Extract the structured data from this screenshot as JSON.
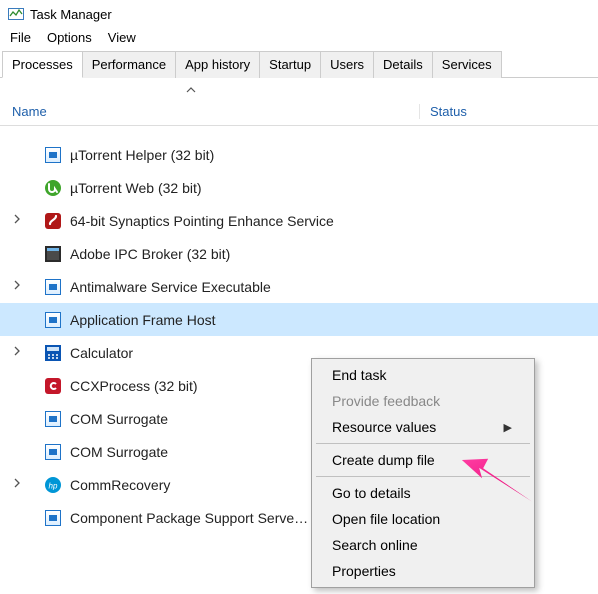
{
  "window": {
    "title": "Task Manager"
  },
  "menubar": {
    "file": "File",
    "options": "Options",
    "view": "View"
  },
  "tabs": {
    "processes": "Processes",
    "performance": "Performance",
    "app_history": "App history",
    "startup": "Startup",
    "users": "Users",
    "details": "Details",
    "services": "Services"
  },
  "columns": {
    "name": "Name",
    "status": "Status"
  },
  "processes": [
    {
      "name": "µTorrent Helper (32 bit)",
      "expandable": false,
      "icon": "app-generic"
    },
    {
      "name": "µTorrent Web (32 bit)",
      "expandable": false,
      "icon": "utorrent"
    },
    {
      "name": "64-bit Synaptics Pointing Enhance Service",
      "expandable": true,
      "icon": "synaptics"
    },
    {
      "name": "Adobe IPC Broker (32 bit)",
      "expandable": false,
      "icon": "adobe-ipc"
    },
    {
      "name": "Antimalware Service Executable",
      "expandable": true,
      "icon": "app-generic"
    },
    {
      "name": "Application Frame Host",
      "expandable": false,
      "icon": "app-generic",
      "selected": true
    },
    {
      "name": "Calculator",
      "expandable": true,
      "icon": "calculator"
    },
    {
      "name": "CCXProcess (32 bit)",
      "expandable": false,
      "icon": "adobe-cc"
    },
    {
      "name": "COM Surrogate",
      "expandable": false,
      "icon": "app-generic"
    },
    {
      "name": "COM Surrogate",
      "expandable": false,
      "icon": "app-generic"
    },
    {
      "name": "CommRecovery",
      "expandable": true,
      "icon": "hp"
    },
    {
      "name": "Component Package Support Serve…",
      "expandable": false,
      "icon": "app-generic"
    }
  ],
  "context_menu": {
    "end_task": "End task",
    "provide_feedback": "Provide feedback",
    "resource_values": "Resource values",
    "create_dump": "Create dump file",
    "go_to_details": "Go to details",
    "open_file_location": "Open file location",
    "search_online": "Search online",
    "properties": "Properties"
  }
}
